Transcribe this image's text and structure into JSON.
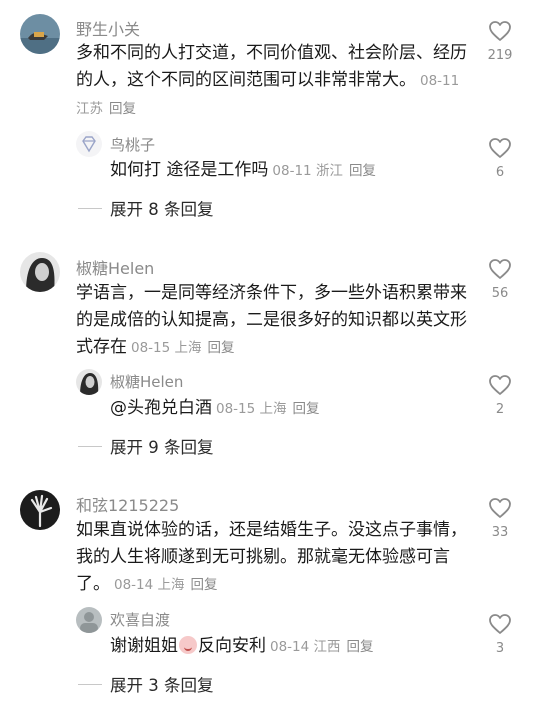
{
  "threads": [
    {
      "comment": {
        "username": "野生小关",
        "text": "多和不同的人打交道，不同价值观、社会阶层、经历的人，这个不同的区间范围可以非常非常大。",
        "date": "08-11",
        "location": "江苏",
        "reply_label": "回复",
        "likes": "219"
      },
      "reply": {
        "username": "鸟桃子",
        "text": "如何打 途径是工作吗",
        "date": "08-11",
        "location": "浙江",
        "reply_label": "回复",
        "likes": "6"
      },
      "expand_label": "展开 8 条回复"
    },
    {
      "comment": {
        "username": "椒糖Helen",
        "text": "学语言，一是同等经济条件下，多一些外语积累带来的是成倍的认知提高，二是很多好的知识都以英文形式存在",
        "date": "08-15",
        "location": "上海",
        "reply_label": "回复",
        "likes": "56"
      },
      "reply": {
        "username": "椒糖Helen",
        "text": "@头孢兑白酒",
        "date": "08-15",
        "location": "上海",
        "reply_label": "回复",
        "likes": "2"
      },
      "expand_label": "展开 9 条回复"
    },
    {
      "comment": {
        "username": "和弦1215225",
        "text": "如果直说体验的话，还是结婚生子。没这点子事情，我的人生将顺遂到无可挑剔。那就毫无体验感可言了。",
        "date": "08-14",
        "location": "上海",
        "reply_label": "回复",
        "likes": "33"
      },
      "reply": {
        "username": "欢喜自渡",
        "text_before_emoji": "谢谢姐姐",
        "text_after_emoji": "反向安利",
        "date": "08-14",
        "location": "江西",
        "reply_label": "回复",
        "likes": "3"
      },
      "expand_label": "展开 3 条回复"
    }
  ],
  "icons": {
    "like": "heart-outline-icon",
    "emoji": "face-emoji-icon"
  }
}
